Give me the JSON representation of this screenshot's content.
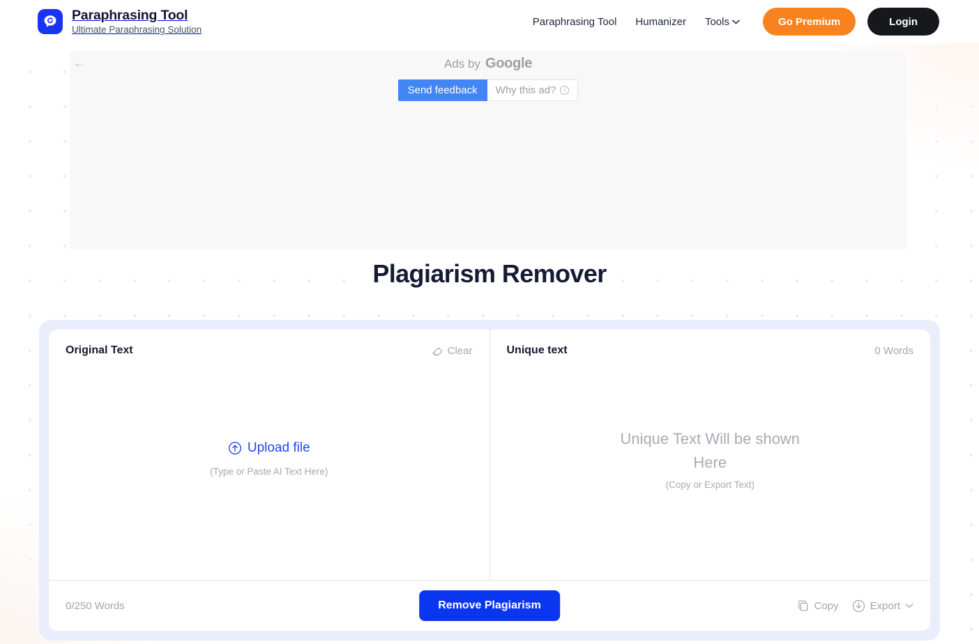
{
  "brand": {
    "title": "Paraphrasing Tool",
    "tagline": "Ultimate Paraphrasing Solution",
    "logo_icon": "speech-bubble-refresh-icon",
    "logo_color": "#1a34f5"
  },
  "nav": {
    "links": [
      {
        "label": "Paraphrasing Tool"
      },
      {
        "label": "Humanizer"
      }
    ],
    "dropdown": {
      "label": "Tools",
      "icon": "chevron-down-icon"
    },
    "premium_button": {
      "label": "Go Premium",
      "color": "#f7821e"
    },
    "login_button": {
      "label": "Login",
      "color": "#17181c"
    }
  },
  "ad": {
    "back_icon": "back-arrow-icon",
    "ads_by": "Ads by",
    "google": "Google",
    "feedback_label": "Send feedback",
    "why_label": "Why this ad?",
    "why_icon": "info-icon",
    "feedback_color": "#4285f4"
  },
  "page": {
    "title": "Plagiarism Remover"
  },
  "editor": {
    "left": {
      "title": "Original Text",
      "clear_label": "Clear",
      "clear_icon": "eraser-icon",
      "upload_label": "Upload file",
      "upload_icon": "upload-circle-icon",
      "hint": "(Type or Paste AI Text Here)"
    },
    "right": {
      "title": "Unique text",
      "word_count": "0 Words",
      "placeholder": "Unique Text Will be shown Here",
      "placeholder_sub": "(Copy or Export Text)"
    },
    "footer": {
      "counter": "0/250 Words",
      "action_label": "Remove Plagiarism",
      "action_color": "#0a36f0",
      "copy_label": "Copy",
      "copy_icon": "copy-icon",
      "export_label": "Export",
      "export_icon": "download-circle-icon",
      "export_chevron_icon": "chevron-down-icon"
    }
  }
}
